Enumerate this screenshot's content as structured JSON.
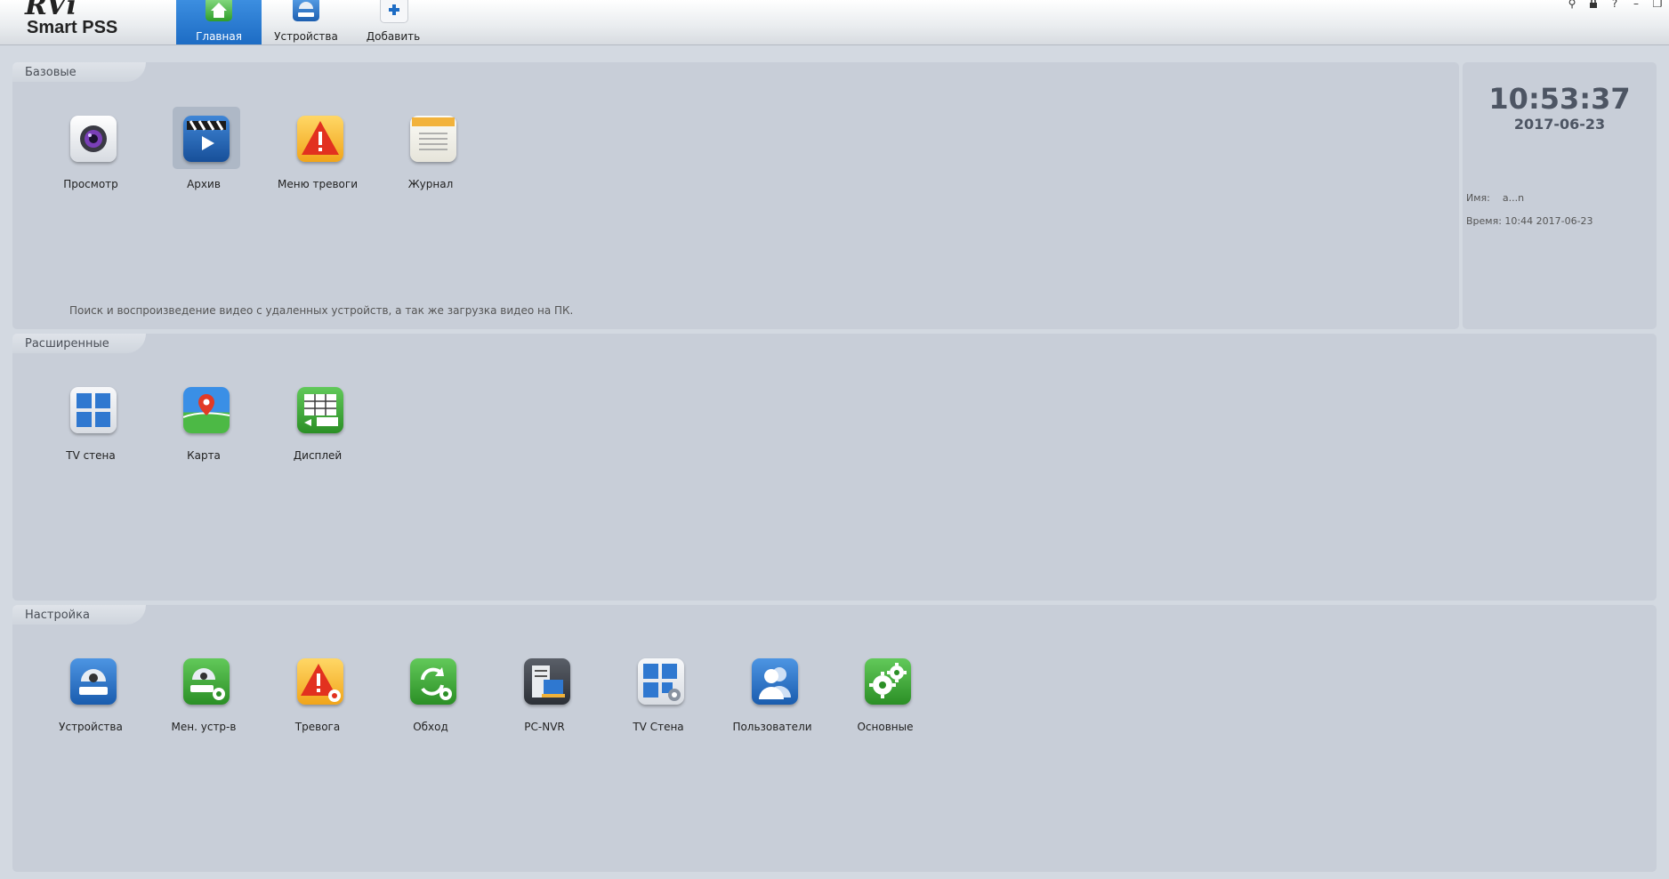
{
  "app": {
    "logo_top": "RVi",
    "logo_bottom": "Smart PSS"
  },
  "nav": {
    "home": "Главная",
    "devices": "Устройства",
    "add": "Добавить"
  },
  "window_buttons": {
    "pin": "⚲",
    "lock": "🔒",
    "help": "?",
    "minimize": "–",
    "restore": "❐"
  },
  "sections": {
    "basic": {
      "title": "Базовые",
      "items": [
        "Просмотр",
        "Архив",
        "Меню тревоги",
        "Журнал"
      ],
      "description": "Поиск и воспроизведение видео с удаленных устройств, а так же загрузка видео на ПК."
    },
    "extended": {
      "title": "Расширенные",
      "items": [
        "TV стена",
        "Карта",
        "Дисплей"
      ]
    },
    "settings": {
      "title": "Настройка",
      "items": [
        "Устройства",
        "Мен. устр-в",
        "Тревога",
        "Обход",
        "PC-NVR",
        "TV Стена",
        "Пользователи",
        "Основные"
      ]
    }
  },
  "status": {
    "time": "10:53:37",
    "date": "2017-06-23",
    "name_label": "Имя:",
    "name_value": "a...n",
    "login_label": "Время:",
    "login_value": "10:44 2017-06-23"
  },
  "colors": {
    "accent": "#1d6cc4",
    "panel": "#c8ced8",
    "background": "#d3d9e1"
  },
  "icons": {
    "home": "home-icon",
    "devices": "camera-dome-icon",
    "add": "plus-icon",
    "preview": "camera-lens-icon",
    "archive": "clapperboard-play-icon",
    "alarm_menu": "warning-triangle-icon",
    "log": "notepad-icon",
    "tv_wall": "grid-screens-icon",
    "map": "map-pin-icon",
    "display": "display-grid-icon"
  }
}
